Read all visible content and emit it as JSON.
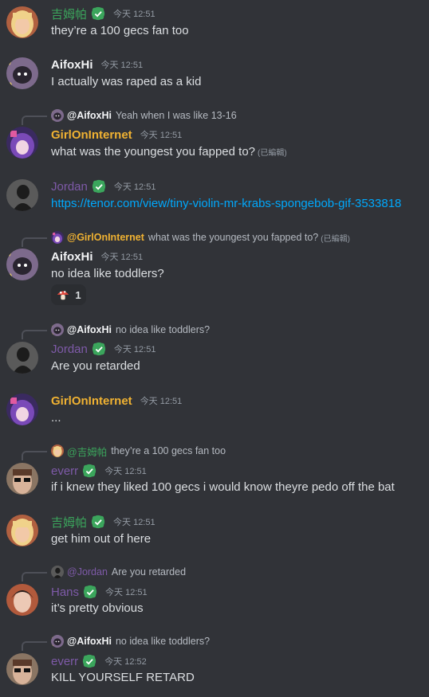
{
  "colors": {
    "green": "#3ba55c",
    "purple": "#7e5aa8",
    "yellow": "#f0b232",
    "white": "#f2f3f5",
    "link": "#00a8fc"
  },
  "messages": [
    {
      "author": "吉姆帕",
      "time": "今天 12:51",
      "text": "they’re a 100 gecs fan too"
    },
    {
      "author": "AifoxHi",
      "time": "今天 12:51",
      "text": "I actually was raped as a kid"
    },
    {
      "reply_to": "@AifoxHi",
      "reply_text": "Yeah when I was like 13-16",
      "author": "GirlOnInternet",
      "time": "今天 12:51",
      "text": "what was the youngest you fapped to?",
      "edited": "(已編輯)"
    },
    {
      "author": "Jordan",
      "time": "今天 12:51",
      "text": "https://tenor.com/view/tiny-violin-mr-krabs-spongebob-gif-3533818"
    },
    {
      "reply_to": "@GirlOnInternet",
      "reply_text": "what was the youngest you fapped to?",
      "reply_edited": "(已編輯)",
      "author": "AifoxHi",
      "time": "今天 12:51",
      "text": "no idea like toddlers?",
      "reaction": {
        "emoji": "mushroom-icon",
        "count": "1"
      }
    },
    {
      "reply_to": "@AifoxHi",
      "reply_text": "no idea like toddlers?",
      "author": "Jordan",
      "time": "今天 12:51",
      "text": "Are you retarded"
    },
    {
      "author": "GirlOnInternet",
      "time": "今天 12:51",
      "text": "..."
    },
    {
      "reply_to": "@吉姆帕",
      "reply_text": "they’re a 100 gecs fan too",
      "author": "everr",
      "time": "今天 12:51",
      "text": "if i knew they liked 100 gecs i would know theyre pedo off the bat"
    },
    {
      "author": "吉姆帕",
      "time": "今天 12:51",
      "text": "get him out of here"
    },
    {
      "reply_to": "@Jordan",
      "reply_text": "Are you retarded",
      "author": "Hans",
      "time": "今天 12:51",
      "text": "it’s pretty obvious"
    },
    {
      "reply_to": "@AifoxHi",
      "reply_text": "no idea like toddlers?",
      "author": "everr",
      "time": "今天 12:52",
      "text": "KILL YOURSELF RETARD"
    }
  ]
}
